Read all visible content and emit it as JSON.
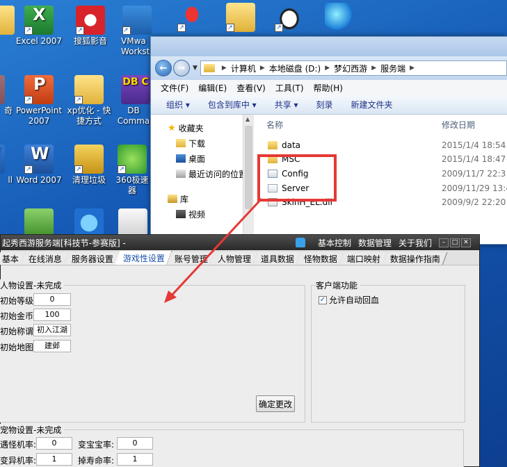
{
  "desktop": {
    "icons": [
      {
        "label": "Excel 2007"
      },
      {
        "label": "搜狐影音"
      },
      {
        "label": "VMwa Worksta"
      },
      {
        "label": "PowerPoint 2007"
      },
      {
        "label": "xp优化 - 快捷方式"
      },
      {
        "label": "DB Comma"
      },
      {
        "label": "Word 2007"
      },
      {
        "label": "清理垃圾"
      },
      {
        "label": "360极速 器"
      },
      {
        "label": "奇"
      },
      {
        "label": "ll"
      }
    ],
    "top_icons": [
      {
        "label": ""
      },
      {
        "label": ""
      },
      {
        "label": ""
      },
      {
        "label": ""
      }
    ]
  },
  "explorer": {
    "address": [
      "计算机",
      "本地磁盘 (D:)",
      "梦幻西游",
      "服务端"
    ],
    "menu": [
      "文件(F)",
      "编辑(E)",
      "查看(V)",
      "工具(T)",
      "帮助(H)"
    ],
    "toolbar": [
      "组织 ▾",
      "包含到库中 ▾",
      "共享 ▾",
      "刻录",
      "新建文件夹"
    ],
    "nav": {
      "favorites": "收藏夹",
      "downloads": "下载",
      "desktop": "桌面",
      "recent": "最近访问的位置",
      "libraries": "库",
      "videos": "视频"
    },
    "columns": {
      "name": "名称",
      "date": "修改日期"
    },
    "files": [
      {
        "name": "data",
        "date": "2015/1/4 18:54"
      },
      {
        "name": "MSC",
        "date": "2015/1/4 18:47"
      },
      {
        "name": "Config",
        "date": "2009/11/7 22:3"
      },
      {
        "name": "Server",
        "date": "2009/11/29 13:4"
      },
      {
        "name": "SkinH_EL.dll",
        "date": "2009/9/2 22:20"
      }
    ]
  },
  "tool": {
    "title": "起秀西游服务端[科技节-参赛版] -",
    "menu": [
      "基本控制",
      "数据管理",
      "关于我们"
    ],
    "tabs": [
      "基本",
      "在线消息",
      "服务器设置",
      "游戏性设置",
      "账号管理",
      "人物管理",
      "道具数据",
      "怪物数据",
      "端口映射",
      "数据操作指南"
    ],
    "char_group": {
      "title": "人物设置-未完成",
      "level_label": "初始等级:",
      "level": "0",
      "gold_label": "初始金币:",
      "gold": "100",
      "title_label": "初始称谓:",
      "title_value": "初入江湖",
      "map_label": "初始地图:",
      "map": "建邺",
      "confirm": "确定更改"
    },
    "client_group": {
      "title": "客户端功能",
      "auto_heal": "允许自动回血",
      "auto_heal_check": "✓"
    },
    "pet_group": {
      "title": "宠物设置-未完成",
      "encounter_label": "遇怪机率:",
      "encounter": "0",
      "rate2_label": "变宝宝率:",
      "rate2": "0",
      "mutate_label": "变异机率:",
      "mutate": "1",
      "lifespan_label": "掉寿命率:",
      "lifespan": "1"
    }
  }
}
